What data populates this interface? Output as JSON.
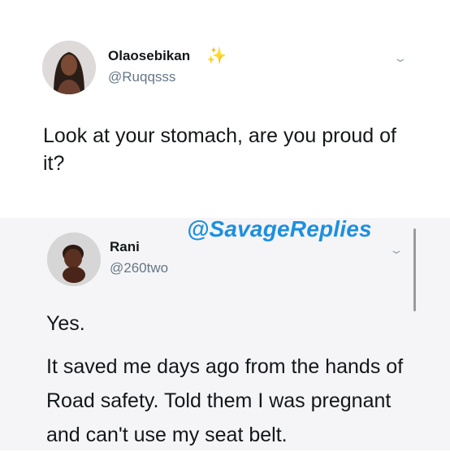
{
  "original_tweet": {
    "display_name": "Olaosebikan",
    "handle": "@Ruqqsss",
    "badge_icon": "sparkles-icon",
    "text": "Look at your stomach, are you proud of it?"
  },
  "watermark": "@SavageReplies",
  "reply_tweet": {
    "display_name": "Rani",
    "handle": "@260two",
    "text_line1": "Yes.",
    "text_body": "It saved me days ago from the hands of Road safety. Told them I was pregnant and can't use my seat belt."
  },
  "colors": {
    "watermark": "#1d8fe0",
    "handle": "#657786",
    "reply_background": "#f5f5f7"
  }
}
